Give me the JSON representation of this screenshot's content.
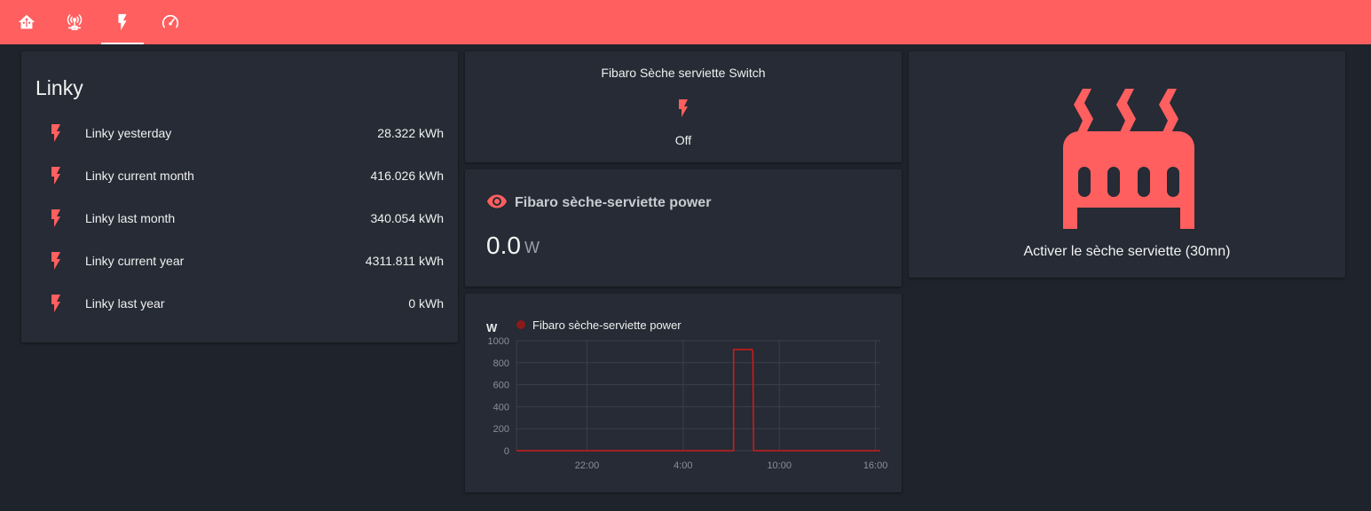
{
  "colors": {
    "header": "#ff5f5f",
    "accent": "#ff5f5f",
    "card": "#262b35",
    "background": "#1f232b",
    "graph_line": "#cc1b1b"
  },
  "header": {
    "tabs": [
      {
        "icon": "home-assistant-icon",
        "active": false
      },
      {
        "icon": "access-point-network-icon",
        "active": false
      },
      {
        "icon": "flash-icon",
        "active": true
      },
      {
        "icon": "speedometer-icon",
        "active": false
      }
    ]
  },
  "linky": {
    "title": "Linky",
    "rows": [
      {
        "name": "Linky yesterday",
        "value": "28.322 kWh",
        "icon": "flash-icon"
      },
      {
        "name": "Linky current month",
        "value": "416.026 kWh",
        "icon": "flash-icon"
      },
      {
        "name": "Linky last month",
        "value": "340.054 kWh",
        "icon": "flash-icon"
      },
      {
        "name": "Linky current year",
        "value": "4311.811 kWh",
        "icon": "flash-icon"
      },
      {
        "name": "Linky last year",
        "value": "0 kWh",
        "icon": "flash-icon"
      }
    ]
  },
  "switch_card": {
    "title": "Fibaro Sèche serviette Switch",
    "state": "Off",
    "icon": "flash-icon"
  },
  "sensor_card": {
    "title": "Fibaro sèche-serviette power",
    "value": "0.0",
    "unit": "W",
    "icon": "eye-icon"
  },
  "button_card": {
    "label": "Activer le sèche serviette (30mn)",
    "icon": "radiator-icon"
  },
  "chart_data": {
    "type": "line",
    "ylabel": "W",
    "ylim": [
      0,
      1000
    ],
    "yticks": [
      0,
      200,
      400,
      600,
      800,
      1000
    ],
    "xticks": [
      "22:00",
      "4:00",
      "10:00",
      "16:00"
    ],
    "xlim_hours": [
      17.6,
      40.3
    ],
    "xtick_hours": [
      22,
      28,
      34,
      40
    ],
    "series": [
      {
        "name": "Fibaro sèche-serviette power",
        "color": "#cc1b1b",
        "points": [
          [
            17.6,
            0
          ],
          [
            31.15,
            0
          ],
          [
            31.15,
            920
          ],
          [
            32.3,
            920
          ],
          [
            32.35,
            900
          ],
          [
            32.4,
            0
          ],
          [
            40.3,
            0
          ]
        ]
      }
    ]
  }
}
